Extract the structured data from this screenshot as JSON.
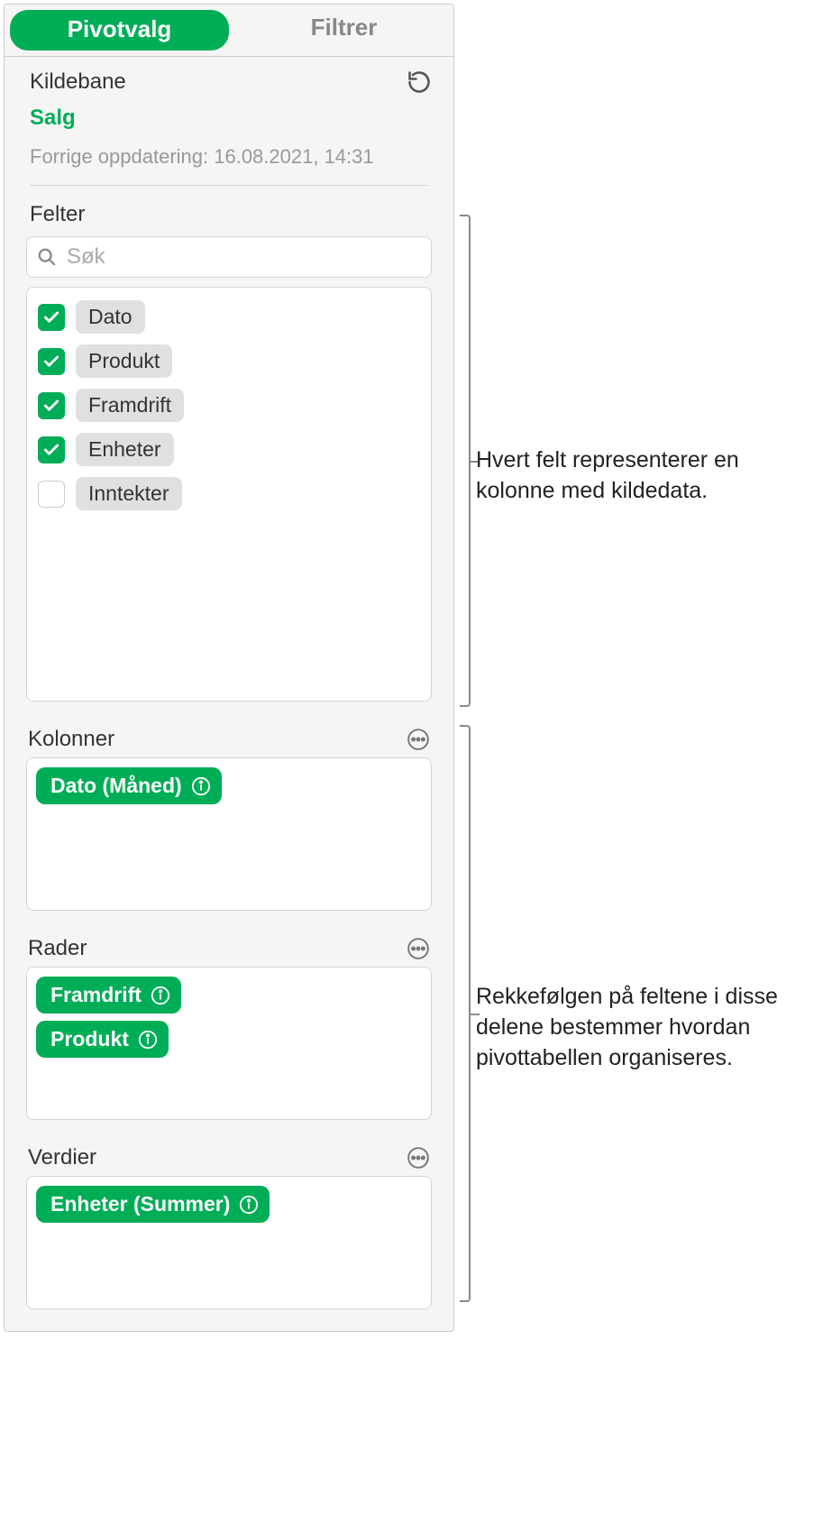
{
  "tabs": {
    "pivot": "Pivotvalg",
    "filter": "Filtrer"
  },
  "source": {
    "heading": "Kildebane",
    "name": "Salg",
    "updated": "Forrige oppdatering: 16.08.2021, 14:31"
  },
  "fields": {
    "heading": "Felter",
    "search_placeholder": "Søk",
    "items": [
      {
        "label": "Dato",
        "checked": true
      },
      {
        "label": "Produkt",
        "checked": true
      },
      {
        "label": "Framdrift",
        "checked": true
      },
      {
        "label": "Enheter",
        "checked": true
      },
      {
        "label": "Inntekter",
        "checked": false
      }
    ]
  },
  "zones": {
    "columns": {
      "title": "Kolonner",
      "items": [
        "Dato (Måned)"
      ]
    },
    "rows": {
      "title": "Rader",
      "items": [
        "Framdrift",
        "Produkt"
      ]
    },
    "values": {
      "title": "Verdier",
      "items": [
        "Enheter (Summer)"
      ]
    }
  },
  "callouts": {
    "fields": "Hvert felt representerer en kolonne med kildedata.",
    "zones": "Rekkefølgen på feltene i disse delene bestemmer hvordan pivottabellen organiseres."
  }
}
